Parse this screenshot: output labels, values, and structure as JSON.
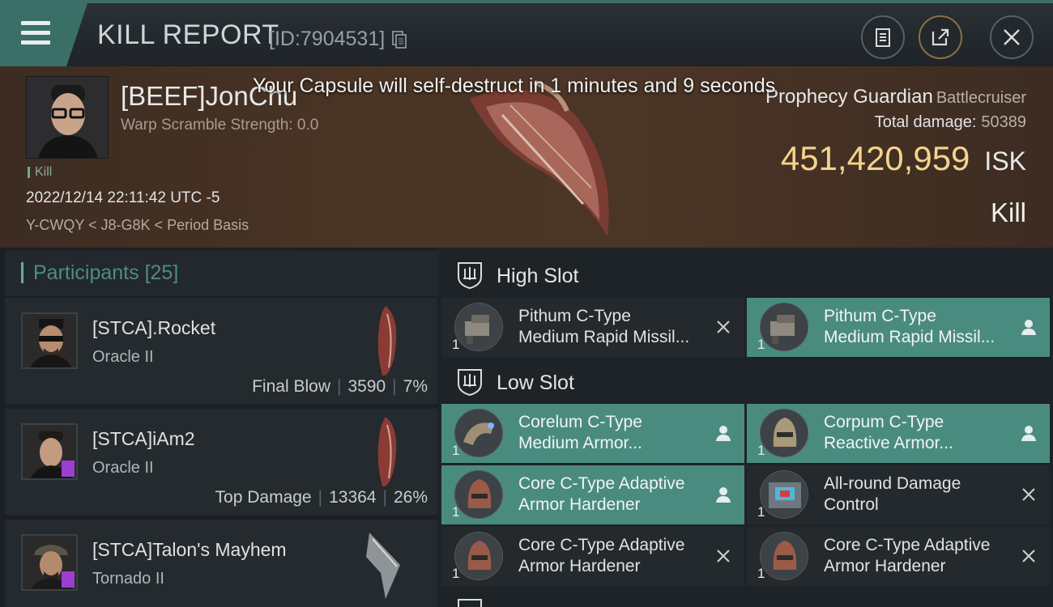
{
  "header": {
    "title": "KILL REPORT",
    "report_id": "[ID:7904531]"
  },
  "victim": {
    "name": "[BEEF]JonChu",
    "warp_scramble": "Warp Scramble Strength: 0.0",
    "tag": "Kill",
    "datetime": "2022/12/14 22:11:42 UTC -5",
    "location": "Y-CWQY < J8-G8K < Period Basis",
    "ship_name": "Prophecy Guardian",
    "ship_class": "Battlecruiser",
    "total_damage_label": "Total damage:",
    "total_damage": "50389",
    "isk_value": "451,420,959",
    "isk_unit": "ISK",
    "result": "Kill"
  },
  "notice": "Your Capsule will self-destruct in 1 minutes and 9 seconds",
  "participants": {
    "title": "Participants",
    "count": "[25]",
    "rows": [
      {
        "name": "[STCA].Rocket",
        "ship": "Oracle II",
        "role": "Final Blow",
        "damage": "3590",
        "percent": "7%"
      },
      {
        "name": "[STCA]iAm2",
        "ship": "Oracle II",
        "role": "Top Damage",
        "damage": "13364",
        "percent": "26%"
      },
      {
        "name": "[STCA]Talon's Mayhem",
        "ship": "Tornado II"
      }
    ]
  },
  "fitting": {
    "high_slot": {
      "label": "High Slot",
      "modules": [
        {
          "line1": "Pithum C-Type",
          "line2": "Medium Rapid Missil...",
          "qty": "1",
          "state": "destroyed"
        },
        {
          "line1": "Pithum C-Type",
          "line2": "Medium Rapid Missil...",
          "qty": "1",
          "state": "dropped"
        }
      ]
    },
    "low_slot": {
      "label": "Low Slot",
      "modules": [
        {
          "line1": "Corelum C-Type",
          "line2": "Medium Armor...",
          "qty": "1",
          "state": "dropped"
        },
        {
          "line1": "Corpum C-Type",
          "line2": "Reactive Armor...",
          "qty": "1",
          "state": "dropped"
        },
        {
          "line1": "Core C-Type Adaptive",
          "line2": "Armor Hardener",
          "qty": "1",
          "state": "dropped"
        },
        {
          "line1": "All-round Damage",
          "line2": "Control",
          "qty": "1",
          "state": "destroyed"
        },
        {
          "line1": "Core C-Type Adaptive",
          "line2": "Armor Hardener",
          "qty": "1",
          "state": "destroyed"
        },
        {
          "line1": "Core C-Type Adaptive",
          "line2": "Armor Hardener",
          "qty": "1",
          "state": "destroyed"
        }
      ]
    }
  },
  "colors": {
    "accent": "#4a8b80",
    "isk": "#f4d48c",
    "background": "#15191d"
  }
}
